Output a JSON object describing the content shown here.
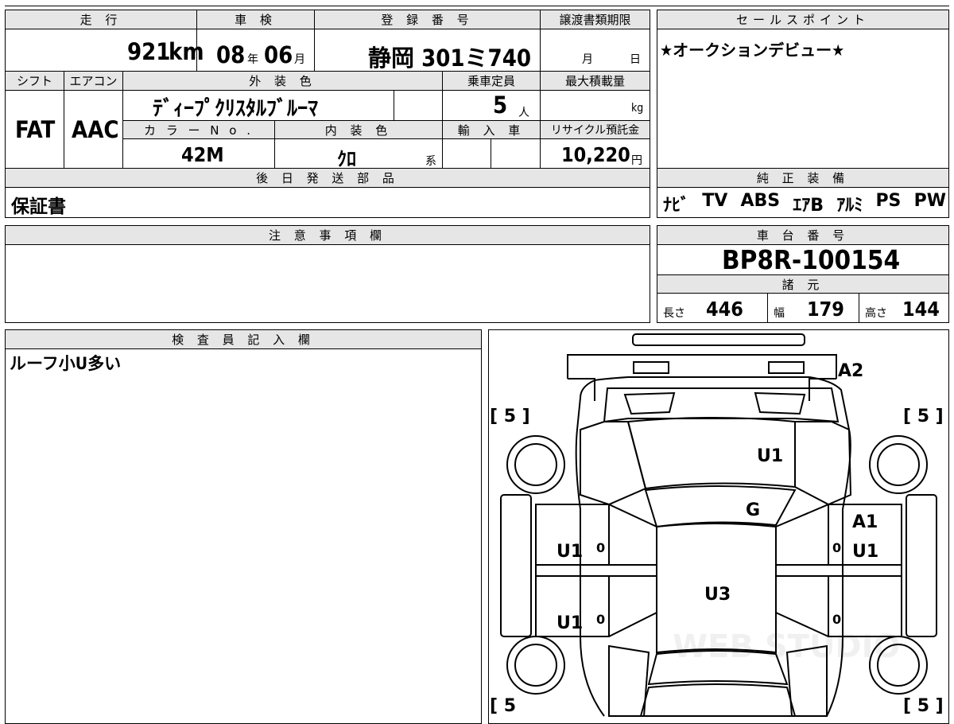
{
  "vehicle": {
    "mileage_header": "走 行",
    "mileage_value": "921",
    "mileage_unit": "km",
    "shaken_header": "車 検",
    "shaken_year": "08",
    "shaken_year_unit": "年",
    "shaken_month": "06",
    "shaken_month_unit": "月",
    "reg_header": "登 録 番 号",
    "reg_value": "静岡 301ミ740",
    "transfer_header": "譲渡書類期限",
    "transfer_month_unit": "月",
    "transfer_day_unit": "日",
    "shift_header": "シフト",
    "shift_value": "FAT",
    "aircon_header": "エアコン",
    "aircon_value": "AAC",
    "exterior_header": "外 装 色",
    "exterior_value": "ﾃﾞｨｰﾌﾟｸﾘｽﾀﾙﾌﾞﾙｰﾏ",
    "capacity_header": "乗車定員",
    "capacity_value": "5",
    "capacity_unit": "人",
    "maxload_header": "最大積載量",
    "maxload_unit": "kg",
    "colorno_header": "カ ラ ー N o .",
    "colorno_value": "42M",
    "interior_header": "内 装 色",
    "interior_value": "ｸﾛ",
    "interior_unit": "系",
    "import_header": "輸 入 車",
    "recycle_header": "リサイクル預託金",
    "recycle_value": "10,220",
    "recycle_unit": "円",
    "later_parts_header": "後 日 発 送 部 品",
    "later_parts_value": "保証書"
  },
  "sales_point": {
    "header": "セールスポイント",
    "text": "★オークションデビュー★"
  },
  "equipment": {
    "header": "純 正 装 備",
    "items": [
      "ﾅﾋﾞ",
      "TV",
      "ABS",
      "ｴｱB",
      "ｱﾙﾐ",
      "PS",
      "PW"
    ]
  },
  "notes": {
    "header": "注 意 事 項 欄",
    "text": ""
  },
  "chassis": {
    "header": "車 台 番 号",
    "value": "BP8R-100154",
    "spec_header": "諸 元",
    "length_label": "長さ",
    "length_value": "446",
    "width_label": "幅",
    "width_value": "179",
    "height_label": "高さ",
    "height_value": "144"
  },
  "inspector": {
    "header": "検 査 員 記 入 欄",
    "text": "ルーフ小U多い"
  },
  "diagram": {
    "tire_tl": "[ 5 ]",
    "tire_tr": "[ 5 ]",
    "tire_bl": "[ 5",
    "tire_br": "[ 5 ]",
    "rear_bumper": "A2",
    "roof": "U1",
    "glass": "G",
    "right_front": "A1",
    "right_front_door": "U1",
    "left_front_door": "U1",
    "left_rear_door": "U1",
    "center": "U3",
    "zero_lf": "0",
    "zero_rf": "0",
    "zero_lr": "0",
    "zero_rr": "0",
    "watermark": "WEB STUDIO"
  }
}
